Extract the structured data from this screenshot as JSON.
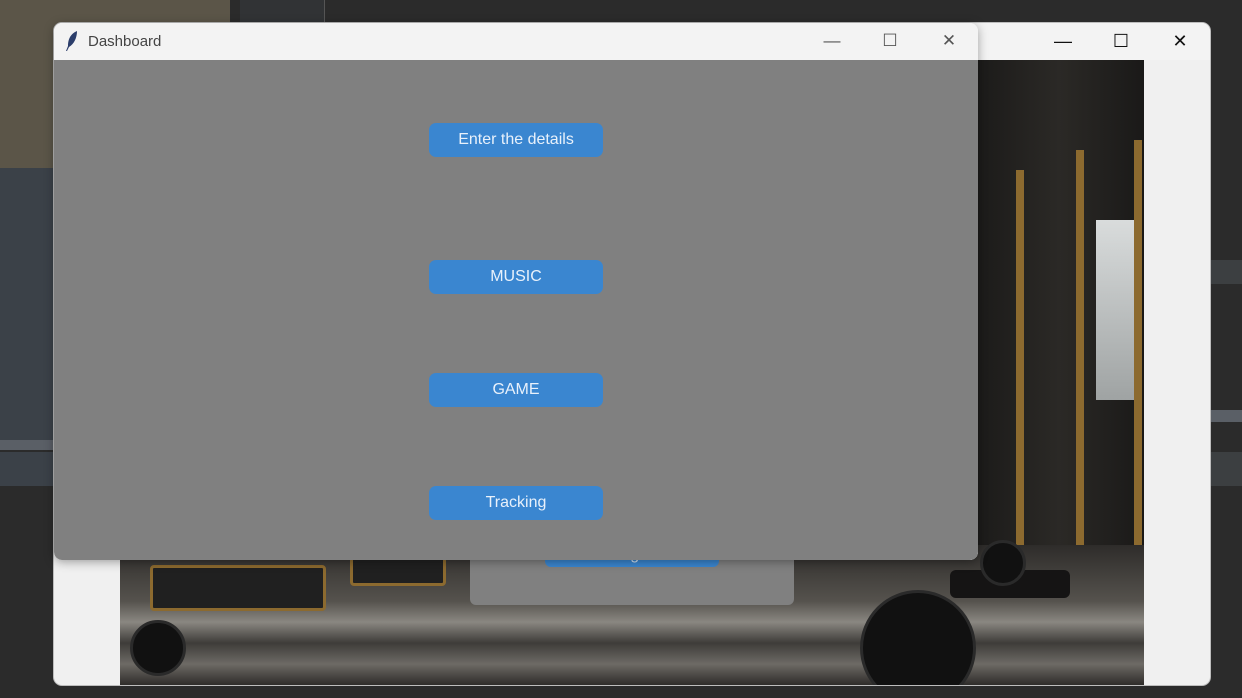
{
  "dashboard": {
    "title": "Dashboard",
    "buttons": {
      "details": "Enter the details",
      "music": "MUSIC",
      "game": "GAME",
      "tracking": "Tracking"
    }
  },
  "login_window": {
    "login_button": "Login"
  },
  "window_controls": {
    "minimize": "—",
    "maximize": "☐",
    "close": "✕"
  },
  "colors": {
    "button_blue": "#3a86d0",
    "panel_gray": "#808080",
    "titlebar": "#f3f3f3"
  }
}
